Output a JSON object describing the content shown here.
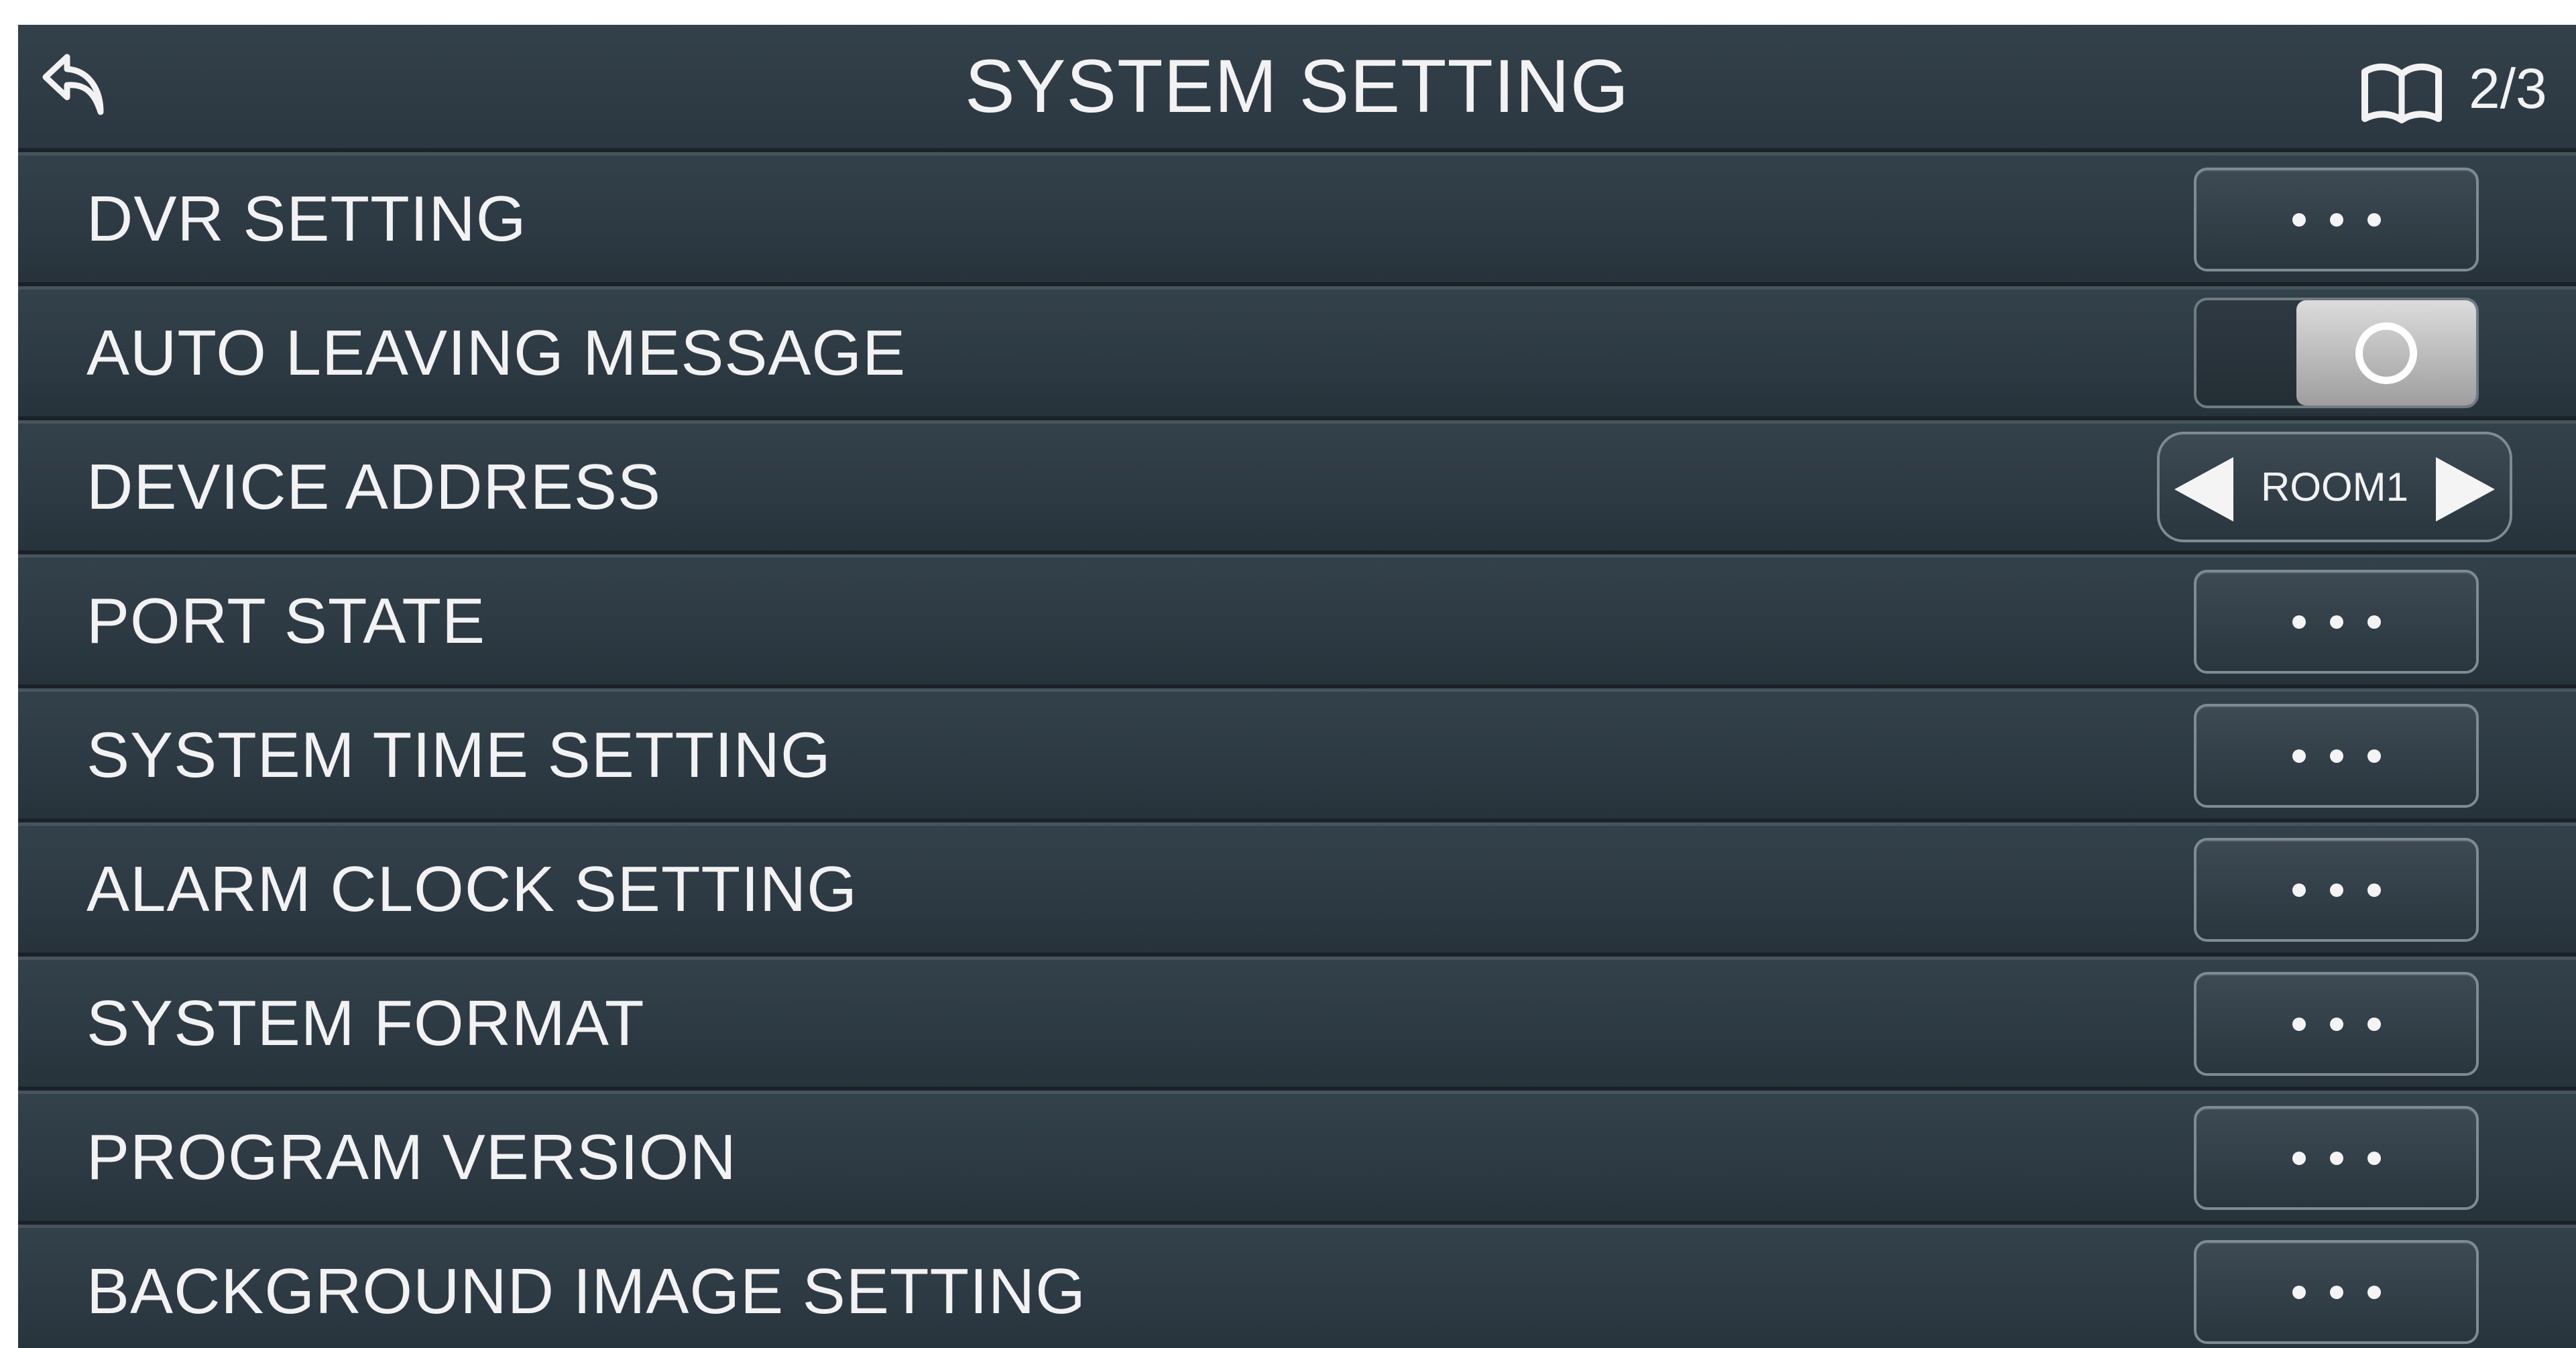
{
  "header": {
    "title": "SYSTEM SETTING",
    "back_icon": "back-arrow-icon",
    "page_icon": "book-icon",
    "page_indicator": "2/3"
  },
  "rows": [
    {
      "label": "DVR SETTING",
      "control": "more-button"
    },
    {
      "label": "AUTO LEAVING MESSAGE",
      "control": "toggle",
      "toggle_on": true
    },
    {
      "label": "DEVICE ADDRESS",
      "control": "stepper",
      "value": "ROOM1"
    },
    {
      "label": "PORT STATE",
      "control": "more-button"
    },
    {
      "label": "SYSTEM TIME SETTING",
      "control": "more-button"
    },
    {
      "label": "ALARM CLOCK SETTING",
      "control": "more-button"
    },
    {
      "label": "SYSTEM FORMAT",
      "control": "more-button"
    },
    {
      "label": "PROGRAM VERSION",
      "control": "more-button"
    },
    {
      "label": "BACKGROUND IMAGE SETTING",
      "control": "more-button"
    }
  ],
  "colors": {
    "panel_background": "#2c3942",
    "text": "#f2f2f2",
    "button_border": "#7f8a92",
    "toggle_knob": "#c8c8c8"
  }
}
